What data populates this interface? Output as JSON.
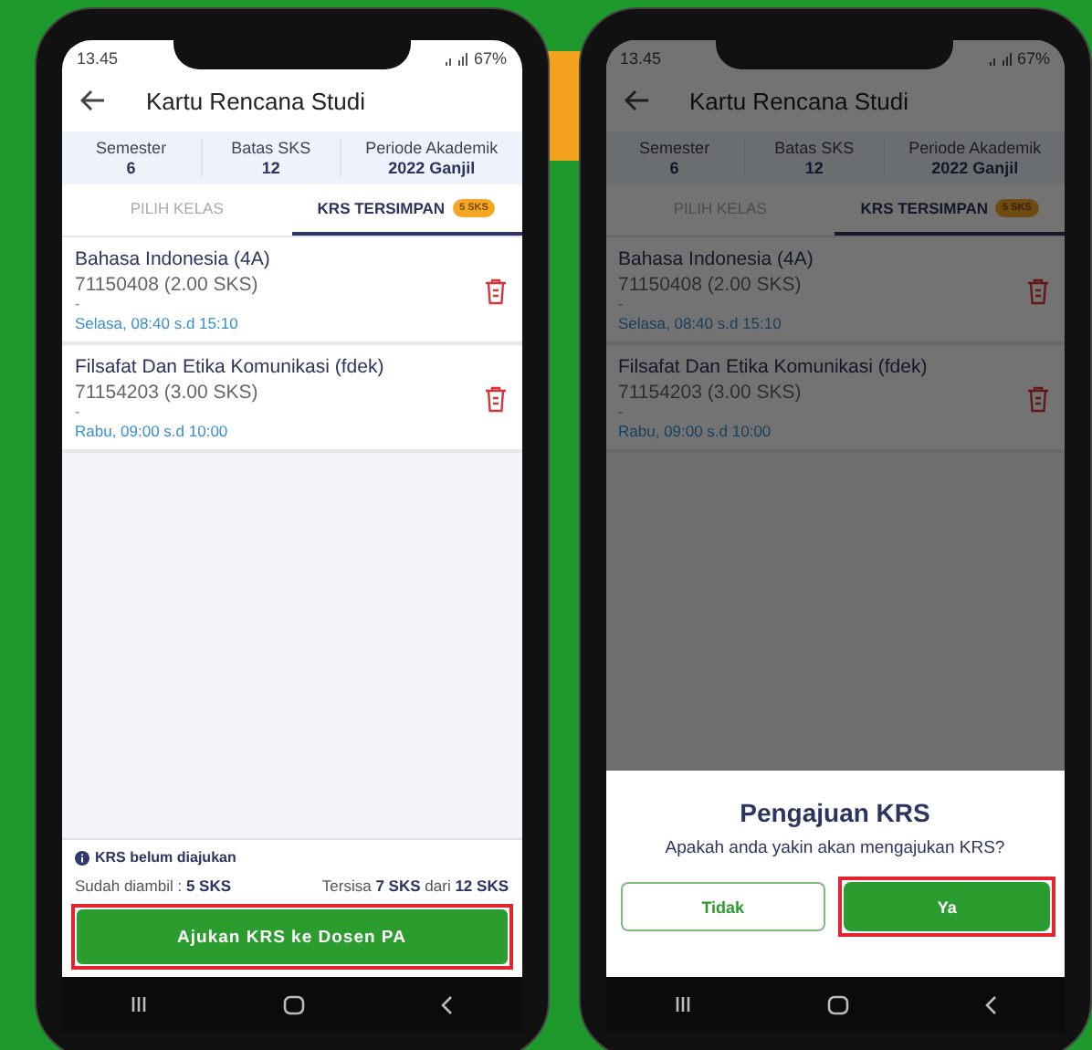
{
  "phones": [
    {
      "dimmed": false,
      "status_bar": {
        "time": "13.45",
        "battery": "67%"
      },
      "app_bar": {
        "title": "Kartu Rencana Studi"
      },
      "info": [
        {
          "label": "Semester",
          "value": "6"
        },
        {
          "label": "Batas SKS",
          "value": "12"
        },
        {
          "label": "Periode Akademik",
          "value": "2022 Ganjil"
        }
      ],
      "tabs": [
        {
          "label": "PILIH KELAS",
          "selected": false
        },
        {
          "label": "KRS TERSIMPAN",
          "badge": "5 SKS",
          "selected": true
        }
      ],
      "courses": [
        {
          "name": "Bahasa Indonesia (4A)",
          "code": "71150408 (2.00 SKS)",
          "note": "-",
          "schedule": "Selasa, 08:40 s.d 15:10"
        },
        {
          "name": "Filsafat Dan Etika Komunikasi (fdek)",
          "code": "71154203 (3.00 SKS)",
          "note": "-",
          "schedule": "Rabu, 09:00 s.d 10:00"
        }
      ],
      "footer": {
        "notice": "KRS belum diajukan",
        "taken": "Sudah diambil : **5 SKS**",
        "remaining": "Tersisa **7 SKS** dari **12 SKS**",
        "button": {
          "label": "Ajukan KRS ke Dosen PA",
          "highlighted": true
        }
      }
    },
    {
      "dimmed": true,
      "status_bar": {
        "time": "13.45",
        "battery": "67%"
      },
      "app_bar": {
        "title": "Kartu Rencana Studi"
      },
      "info": [
        {
          "label": "Semester",
          "value": "6"
        },
        {
          "label": "Batas SKS",
          "value": "12"
        },
        {
          "label": "Periode Akademik",
          "value": "2022 Ganjil"
        }
      ],
      "tabs": [
        {
          "label": "PILIH KELAS",
          "selected": false
        },
        {
          "label": "KRS TERSIMPAN",
          "badge": "5 SKS",
          "selected": true
        }
      ],
      "courses": [
        {
          "name": "Bahasa Indonesia (4A)",
          "code": "71150408 (2.00 SKS)",
          "note": "-",
          "schedule": "Selasa, 08:40 s.d 15:10"
        },
        {
          "name": "Filsafat Dan Etika Komunikasi (fdek)",
          "code": "71154203 (3.00 SKS)",
          "note": "-",
          "schedule": "Rabu, 09:00 s.d 10:00"
        }
      ],
      "dialog": {
        "title": "Pengajuan KRS",
        "message": "Apakah anda yakin akan mengajukan KRS?",
        "buttons": [
          {
            "label": "Tidak",
            "kind": "outline",
            "highlighted": false
          },
          {
            "label": "Ya",
            "kind": "primary",
            "highlighted": true
          }
        ]
      }
    }
  ]
}
